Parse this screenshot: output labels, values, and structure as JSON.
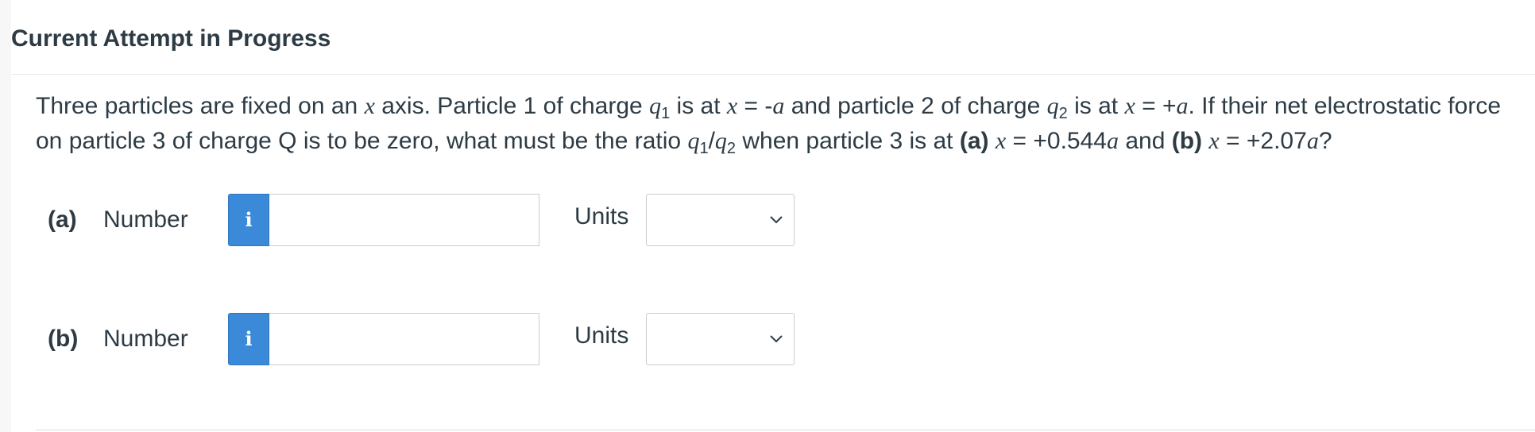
{
  "header": {
    "title": "Current Attempt in Progress"
  },
  "question": {
    "t1": "Three particles are fixed on an ",
    "x1": "x",
    "t2": " axis. Particle 1 of charge ",
    "q": "q",
    "sub1": "1",
    "t3": " is at ",
    "x2": "x",
    "t4": " = -",
    "a1": "a",
    "t5": " and particle 2 of charge ",
    "q2": "q",
    "sub2": "2",
    "t6": " is at ",
    "x3": "x",
    "t7": " = +",
    "a2": "a",
    "t8": ". If their net electrostatic force on particle 3 of charge Q is to be zero, what must be the ratio ",
    "q3": "q",
    "sub3": "1",
    "slash": "/",
    "q4": "q",
    "sub4": "2",
    "t9": " when particle 3 is at ",
    "pa": "(a)",
    "t10": " ",
    "x4": "x",
    "t11": " = +0.544",
    "a3": "a",
    "t12": " and ",
    "pb": "(b)",
    "t13": " ",
    "x5": "x",
    "t14": " = +2.07",
    "a4": "a",
    "t15": "?"
  },
  "parts": [
    {
      "label": "(a)",
      "number_label": "Number",
      "info_icon": "i",
      "input_value": "",
      "units_label": "Units",
      "units_selected": ""
    },
    {
      "label": "(b)",
      "number_label": "Number",
      "info_icon": "i",
      "input_value": "",
      "units_label": "Units",
      "units_selected": ""
    }
  ],
  "colors": {
    "accent": "#3b8ad9",
    "text": "#2d3b45",
    "border": "#c7cdd1"
  }
}
